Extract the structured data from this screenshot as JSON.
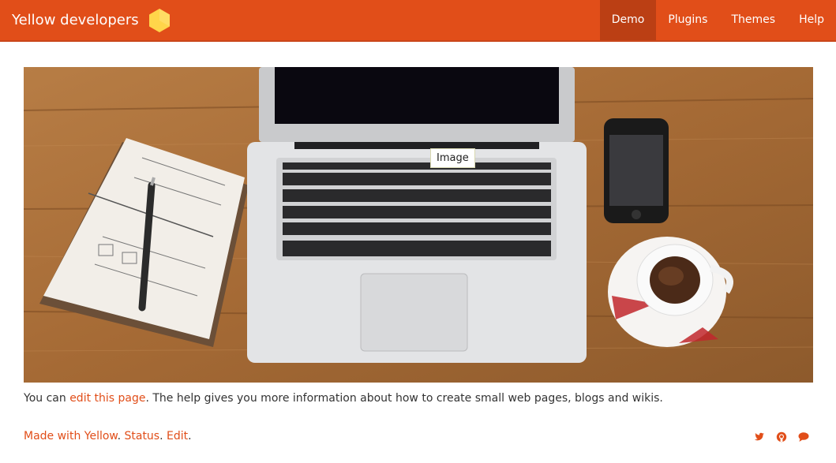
{
  "header": {
    "brand": "Yellow developers",
    "nav": [
      {
        "label": "Demo",
        "active": true
      },
      {
        "label": "Plugins",
        "active": false
      },
      {
        "label": "Themes",
        "active": false
      },
      {
        "label": "Help",
        "active": false
      }
    ]
  },
  "hero": {
    "image_label": "Image"
  },
  "content": {
    "text_before": "You can ",
    "link": "edit this page",
    "text_after": ". The help gives you more information about how to create small web pages, blogs and wikis."
  },
  "footer": {
    "made_with": "Made with Yellow",
    "sep1": ". ",
    "status": "Status",
    "sep2": ". ",
    "edit": "Edit",
    "sep3": "."
  },
  "social": [
    "twitter-icon",
    "github-icon",
    "chat-icon"
  ],
  "colors": {
    "accent": "#e14e19",
    "nav_active": "#bb3f14",
    "logo": "#ffd54a",
    "text": "#333333"
  }
}
